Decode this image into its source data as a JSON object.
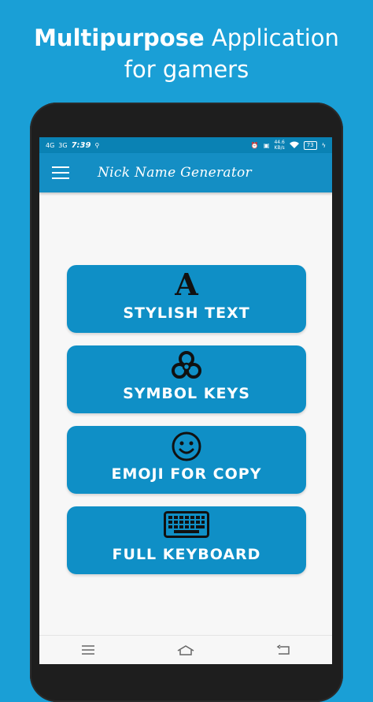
{
  "headline": {
    "bold": "Multipurpose",
    "rest": " Application",
    "line2": "for gamers"
  },
  "statusbar": {
    "net1": "4G",
    "net2": "3G",
    "time": "7:39",
    "speed": "44.6",
    "speed_unit": "KB/s",
    "battery": "73"
  },
  "appbar": {
    "title": "Nick Name Generator"
  },
  "menu": [
    {
      "label": "STYLISH TEXT",
      "icon": "gothic-letter-a-icon",
      "glyph": "A"
    },
    {
      "label": "SYMBOL KEYS",
      "icon": "biohazard-icon"
    },
    {
      "label": "EMOJI FOR COPY",
      "icon": "smiley-face-icon"
    },
    {
      "label": "FULL KEYBOARD",
      "icon": "keyboard-icon"
    }
  ],
  "colors": {
    "background": "#1a9fd6",
    "statusbar": "#0a82b4",
    "appbar": "#148ec4",
    "button": "#0f8fc6",
    "screen": "#f7f7f7"
  }
}
